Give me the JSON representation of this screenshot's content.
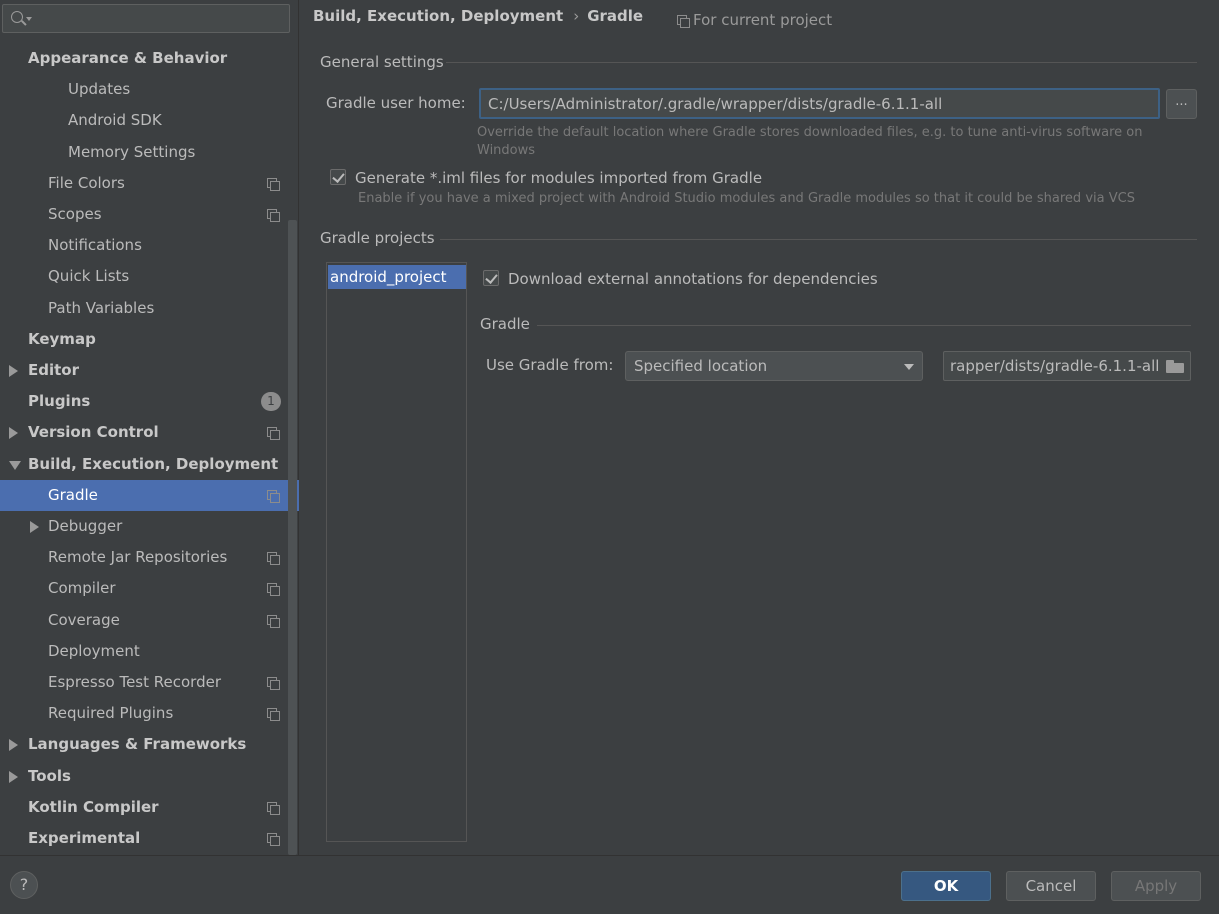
{
  "sidebar": {
    "search": {
      "value": "",
      "placeholder": ""
    },
    "items": [
      {
        "label": "Appearance & Behavior",
        "level": 0,
        "bold": true,
        "arrow": "none"
      },
      {
        "label": "Updates",
        "level": 2
      },
      {
        "label": "Android SDK",
        "level": 2
      },
      {
        "label": "Memory Settings",
        "level": 2
      },
      {
        "label": "File Colors",
        "level": 1,
        "copy": true
      },
      {
        "label": "Scopes",
        "level": 1,
        "copy": true
      },
      {
        "label": "Notifications",
        "level": 1
      },
      {
        "label": "Quick Lists",
        "level": 1
      },
      {
        "label": "Path Variables",
        "level": 1
      },
      {
        "label": "Keymap",
        "level": 0,
        "bold": true
      },
      {
        "label": "Editor",
        "level": 0,
        "bold": true,
        "arrow": "right"
      },
      {
        "label": "Plugins",
        "level": 0,
        "bold": true,
        "badge": "1"
      },
      {
        "label": "Version Control",
        "level": 0,
        "bold": true,
        "arrow": "right",
        "copy": true
      },
      {
        "label": "Build, Execution, Deployment",
        "level": 0,
        "bold": true,
        "arrow": "down"
      },
      {
        "label": "Gradle",
        "level": 1,
        "copy": true,
        "selected": true
      },
      {
        "label": "Debugger",
        "level": 1,
        "arrow": "right"
      },
      {
        "label": "Remote Jar Repositories",
        "level": 1,
        "copy": true
      },
      {
        "label": "Compiler",
        "level": 1,
        "copy": true
      },
      {
        "label": "Coverage",
        "level": 1,
        "copy": true
      },
      {
        "label": "Deployment",
        "level": 1
      },
      {
        "label": "Espresso Test Recorder",
        "level": 1,
        "copy": true
      },
      {
        "label": "Required Plugins",
        "level": 1,
        "copy": true
      },
      {
        "label": "Languages & Frameworks",
        "level": 0,
        "bold": true,
        "arrow": "right"
      },
      {
        "label": "Tools",
        "level": 0,
        "bold": true,
        "arrow": "right"
      },
      {
        "label": "Kotlin Compiler",
        "level": 0,
        "bold": true,
        "copy": true
      },
      {
        "label": "Experimental",
        "level": 0,
        "bold": true,
        "copy": true
      }
    ]
  },
  "header": {
    "breadcrumb_parent": "Build, Execution, Deployment",
    "breadcrumb_separator": "›",
    "breadcrumb_current": "Gradle",
    "scope_label": "For current project"
  },
  "general": {
    "title": "General settings",
    "home_label": "Gradle user home:",
    "home_value": "C:/Users/Administrator/.gradle/wrapper/dists/gradle-6.1.1-all",
    "browse_label": "...",
    "home_hint_line1": "Override the default location where Gradle stores downloaded files, e.g. to tune anti-virus software on",
    "home_hint_line2": "Windows",
    "iml_label": "Generate *.iml files for modules imported from Gradle",
    "iml_checked": true,
    "iml_hint": "Enable if you have a mixed project with Android Studio modules and Gradle modules so that it could be shared via VCS"
  },
  "projects": {
    "title": "Gradle projects",
    "items": [
      "android_project"
    ],
    "annotations_label": "Download external annotations for dependencies",
    "annotations_checked": true,
    "gradle_group_title": "Gradle",
    "use_from_label": "Use Gradle from:",
    "use_from_value": "Specified location",
    "gradle_path_value": "rapper/dists/gradle-6.1.1-all"
  },
  "footer": {
    "help_label": "?",
    "ok_label": "OK",
    "cancel_label": "Cancel",
    "apply_label": "Apply"
  },
  "colors": {
    "background": "#3c3f41",
    "selection": "#4b6eaf",
    "ok_button": "#365880",
    "text": "#bbbbbb"
  },
  "icons": [
    "search-icon",
    "copy-icon",
    "folder-icon",
    "expand-arrow-icon",
    "collapse-arrow-icon",
    "checkbox-check-icon",
    "dropdown-arrow-icon"
  ]
}
